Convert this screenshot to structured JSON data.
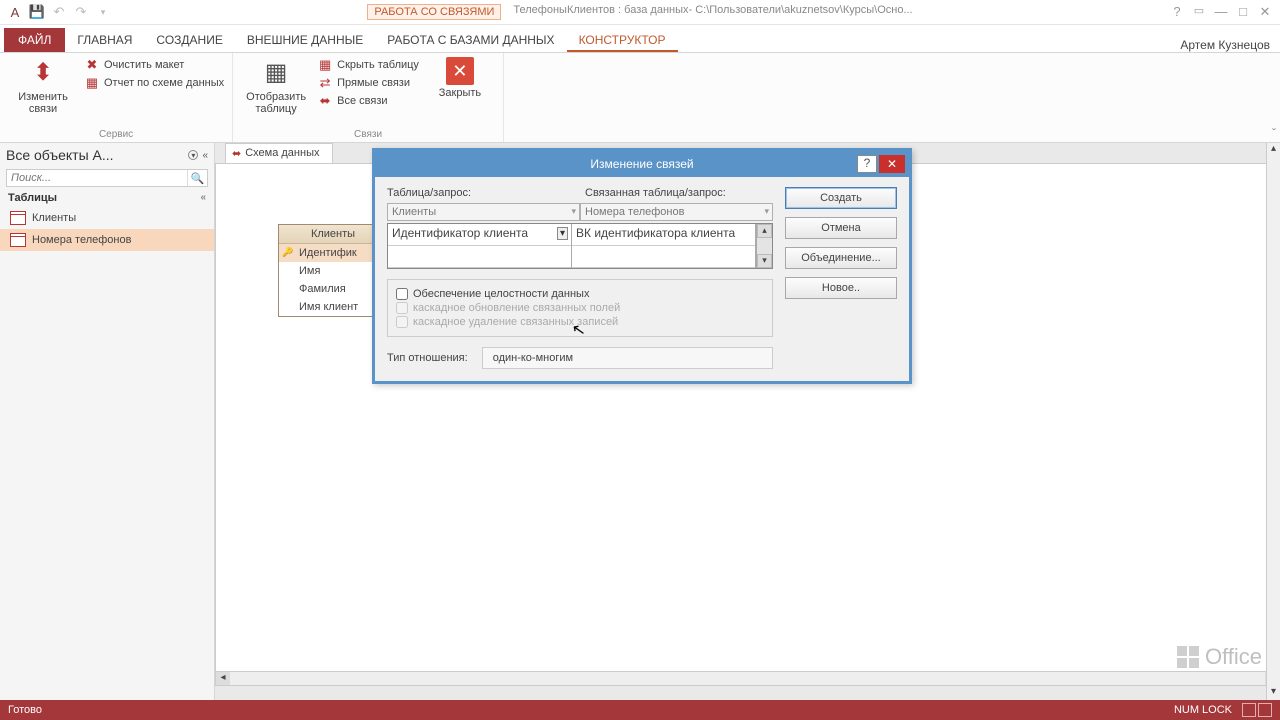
{
  "titlebar": {
    "context_label": "РАБОТА СО СВЯЗЯМИ",
    "doc_title": "ТелефоныКлиентов : база данных- C:\\Пользователи\\akuznetsov\\Курсы\\Осно..."
  },
  "tabs": {
    "file": "ФАЙЛ",
    "home": "ГЛАВНАЯ",
    "create": "СОЗДАНИЕ",
    "external": "ВНЕШНИЕ ДАННЫЕ",
    "dbtools": "РАБОТА С БАЗАМИ ДАННЫХ",
    "design": "КОНСТРУКТОР",
    "user": "Артем Кузнецов"
  },
  "ribbon": {
    "edit_rel": "Изменить связи",
    "clear_layout": "Очистить макет",
    "rel_report": "Отчет по схеме данных",
    "show_table": "Отобразить таблицу",
    "hide_table": "Скрыть таблицу",
    "direct_rel": "Прямые связи",
    "all_rel": "Все связи",
    "close": "Закрыть",
    "grp_service": "Сервис",
    "grp_rel": "Связи"
  },
  "nav": {
    "header": "Все объекты A...",
    "search_placeholder": "Поиск...",
    "section": "Таблицы",
    "items": [
      "Клиенты",
      "Номера телефонов"
    ]
  },
  "doctab": "Схема данных",
  "tablebox": {
    "title": "Клиенты",
    "rows": [
      "Идентифик",
      "Имя",
      "Фамилия",
      "Имя клиент"
    ]
  },
  "dialog": {
    "title": "Изменение связей",
    "lbl_table": "Таблица/запрос:",
    "lbl_related": "Связанная таблица/запрос:",
    "combo_left": "Клиенты",
    "combo_right": "Номера телефонов",
    "field_left": "Идентификатор клиента",
    "field_right": "ВК идентификатора клиента",
    "chk_integrity": "Обеспечение целостности данных",
    "chk_cascade_update": "каскадное обновление связанных полей",
    "chk_cascade_delete": "каскадное удаление связанных записей",
    "lbl_reltype": "Тип отношения:",
    "reltype_value": "один-ко-многим",
    "btn_create": "Создать",
    "btn_cancel": "Отмена",
    "btn_join": "Объединение...",
    "btn_new": "Новое.."
  },
  "status": {
    "ready": "Готово",
    "numlock": "NUM LOCK"
  },
  "office": "Office"
}
